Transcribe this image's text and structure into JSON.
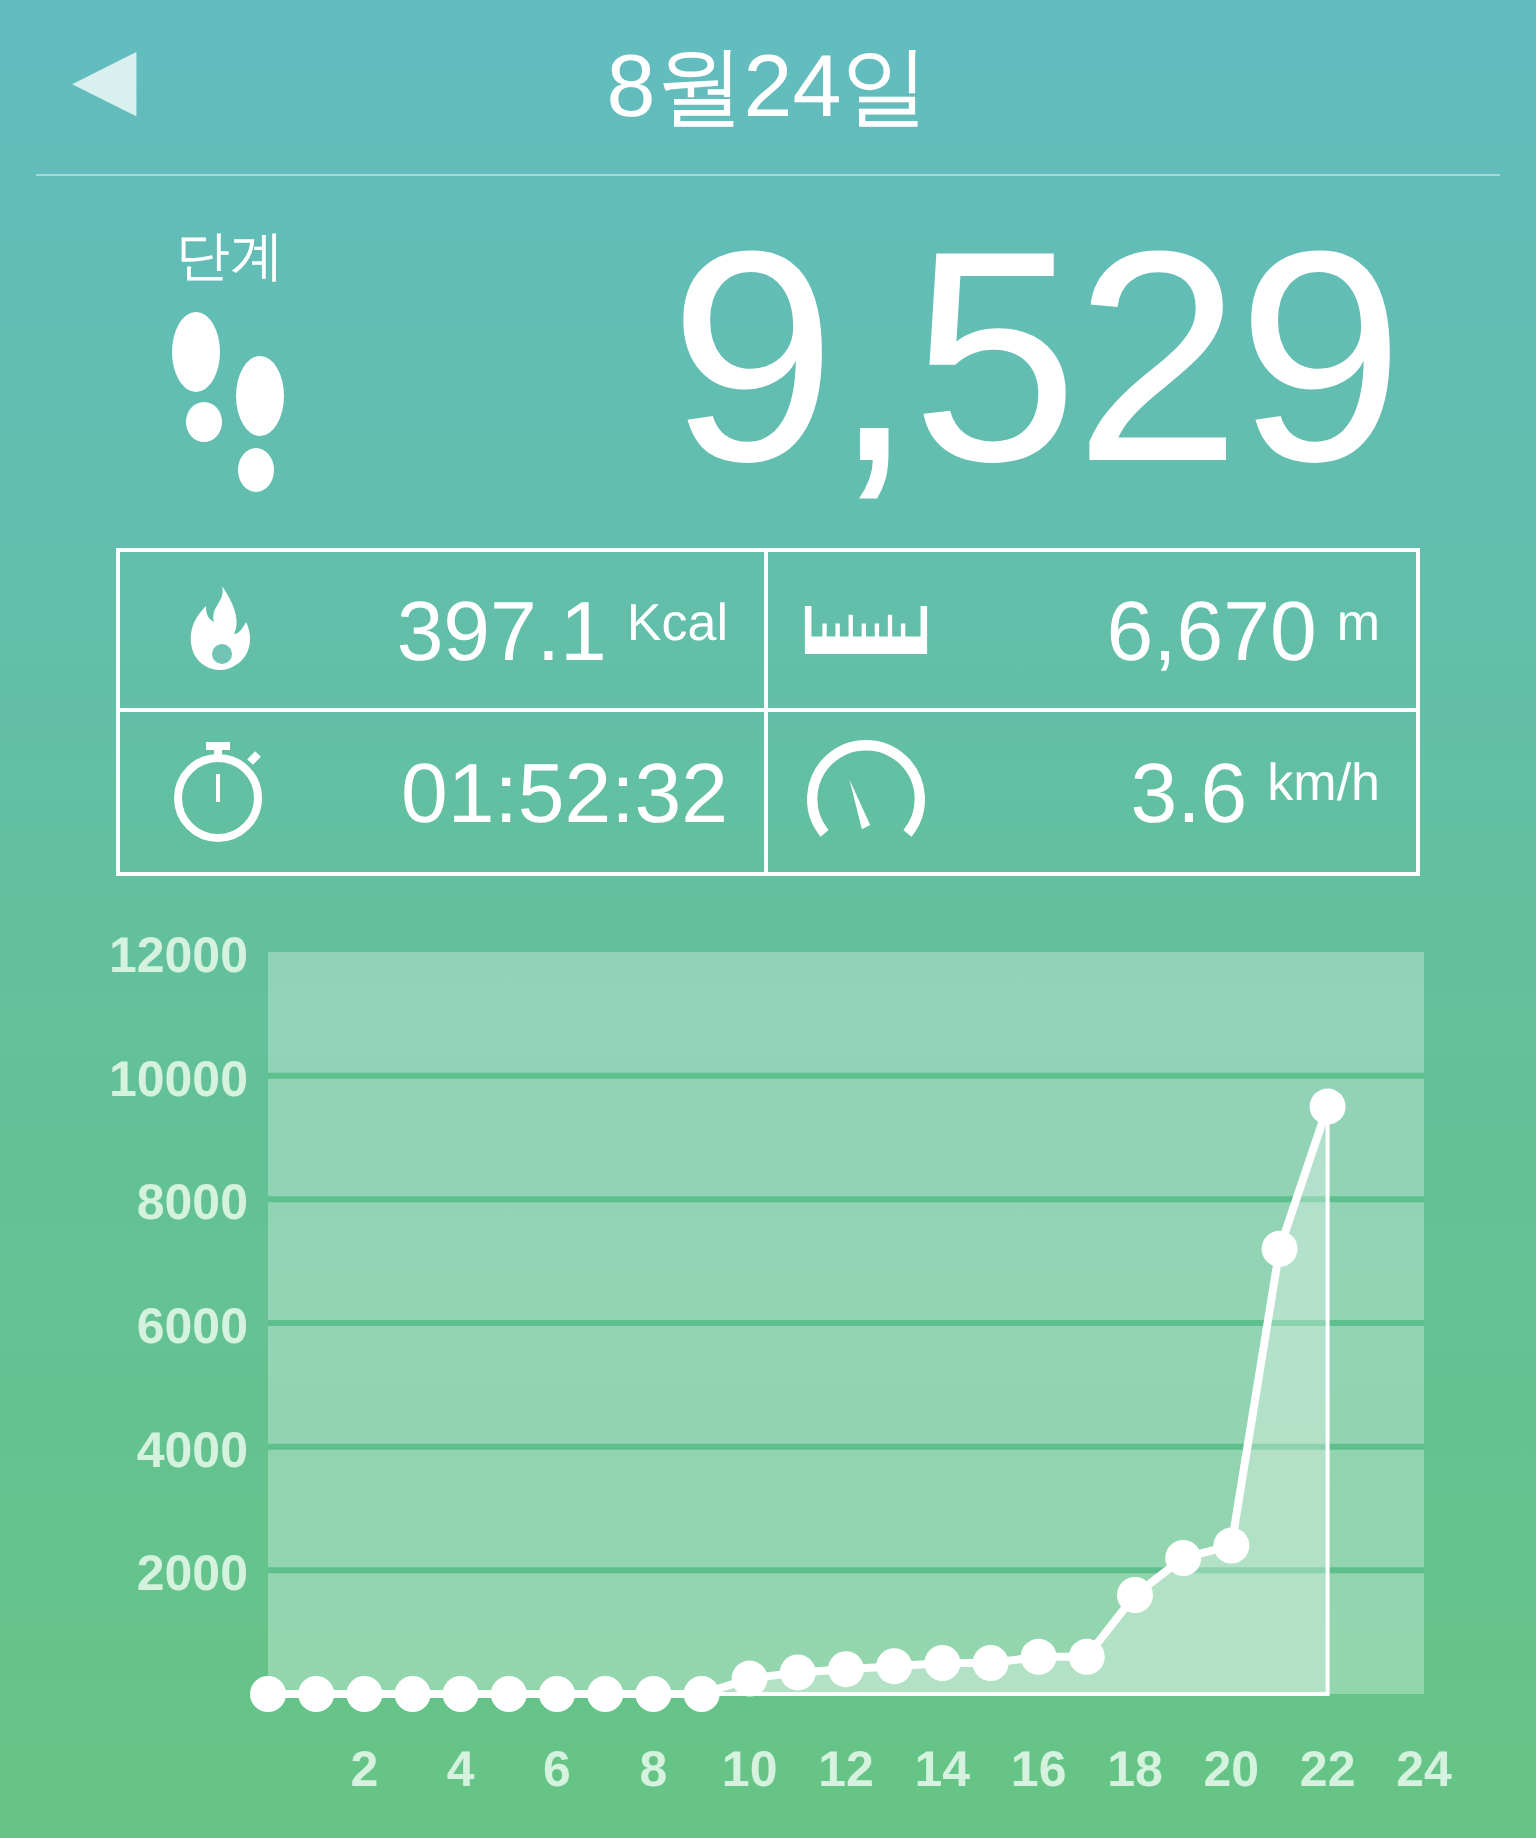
{
  "header": {
    "back": "◀",
    "title": "8월24일"
  },
  "steps": {
    "label": "단계",
    "value": "9,529"
  },
  "stats": [
    {
      "kind": "calories",
      "value": "397.1",
      "unit": "Kcal"
    },
    {
      "kind": "distance",
      "value": "6,670",
      "unit": "m"
    },
    {
      "kind": "time",
      "value": "01:52:32"
    },
    {
      "kind": "speed",
      "value": "3.6",
      "unit": "km/h"
    }
  ],
  "chart": {
    "chart_data": {
      "type": "area",
      "x": [
        0,
        1,
        2,
        3,
        4,
        5,
        6,
        7,
        8,
        9,
        10,
        11,
        12,
        13,
        14,
        15,
        16,
        17,
        18,
        19,
        20,
        21,
        22
      ],
      "series": [
        {
          "color": "#ffffff",
          "values": [
            0,
            0,
            0,
            0,
            0,
            0,
            0,
            0,
            0,
            0,
            250,
            350,
            400,
            450,
            500,
            500,
            600,
            600,
            1600,
            2200,
            2400,
            7200,
            9500
          ]
        }
      ],
      "grid": true,
      "xlim": [
        0,
        24
      ],
      "ylim": [
        0,
        12000
      ],
      "xticks": [
        2,
        4,
        6,
        8,
        10,
        12,
        14,
        16,
        18,
        20,
        22,
        24
      ],
      "yticks": [
        2000,
        4000,
        6000,
        8000,
        10000,
        12000
      ]
    }
  }
}
